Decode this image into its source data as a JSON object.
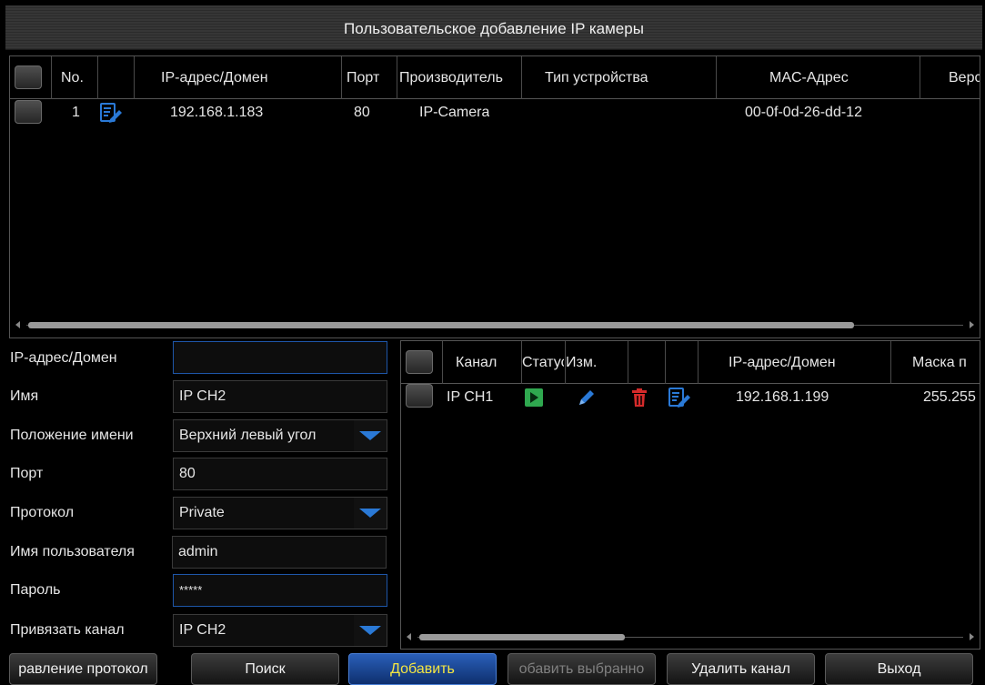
{
  "title": "Пользовательское добавление IP камеры",
  "search_table": {
    "columns": [
      "No.",
      "IP-адрес/Домен",
      "Порт",
      "Производитель",
      "Тип устройства",
      "MAC-Адрес",
      "Верс"
    ],
    "rows": [
      {
        "no": "1",
        "ip": "192.168.1.183",
        "port": "80",
        "manufacturer": "IP-Camera",
        "device_type": "",
        "mac": "00-0f-0d-26-dd-12",
        "version": ""
      }
    ],
    "scroll_position": 0.98
  },
  "form": {
    "ip_label": "IP-адрес/Домен",
    "ip_value": "",
    "name_label": "Имя",
    "name_value": "IP CH2",
    "name_position_label": "Положение имени",
    "name_position_value": "Верхний левый угол",
    "port_label": "Порт",
    "port_value": "80",
    "protocol_label": "Протокол",
    "protocol_value": "Private",
    "username_label": "Имя пользователя",
    "username_value": "admin",
    "password_label": "Пароль",
    "password_value": "*****",
    "bind_channel_label": "Привязать канал",
    "bind_channel_value": "IP CH2"
  },
  "channel_table": {
    "columns": [
      "Канал",
      "Статус",
      "Изм.",
      "IP-адрес/Домен",
      "Маска п"
    ],
    "rows": [
      {
        "channel": "IP CH1",
        "ip": "192.168.1.199",
        "mask": "255.255"
      }
    ],
    "scroll_position": 0.0
  },
  "buttons": {
    "protocol_manage": "равление протокол",
    "search": "Поиск",
    "add": "Добавить",
    "add_selected": "обавить выбранно",
    "delete_channel": "Удалить канал",
    "exit": "Выход"
  },
  "icons": {
    "edit": "edit-icon",
    "play": "play-icon",
    "pencil": "pencil-icon",
    "trash": "trash-icon"
  },
  "colors": {
    "accent_blue": "#2a79d6",
    "status_green": "#2fa84f",
    "delete_red": "#d42a2a",
    "primary_text": "#f5e642"
  }
}
